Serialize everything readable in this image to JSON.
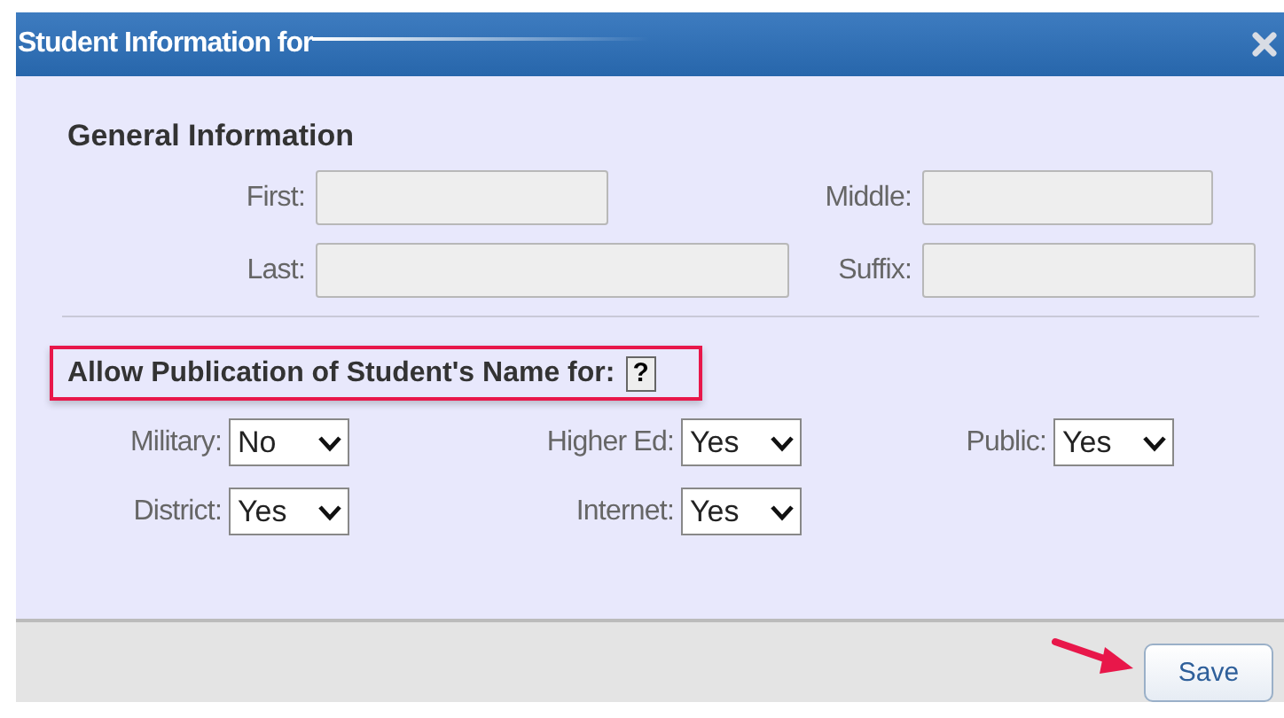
{
  "window": {
    "title": "Student Information for"
  },
  "general": {
    "heading": "General Information",
    "rows": [
      [
        {
          "label": "First:"
        },
        {
          "label": "Middle:"
        }
      ],
      [
        {
          "label": "Last:"
        },
        {
          "label": "Suffix:"
        }
      ]
    ]
  },
  "publication": {
    "heading": "Allow Publication of Student's Name for:",
    "help": "?",
    "rows": [
      [
        {
          "label": "Military:",
          "value": "No"
        },
        {
          "label": "Higher Ed:",
          "value": "Yes"
        },
        {
          "label": "Public:",
          "value": "Yes"
        }
      ],
      [
        {
          "label": "District:",
          "value": "Yes"
        },
        {
          "label": "Internet:",
          "value": "Yes"
        }
      ]
    ]
  },
  "buttons": [
    "Save"
  ]
}
